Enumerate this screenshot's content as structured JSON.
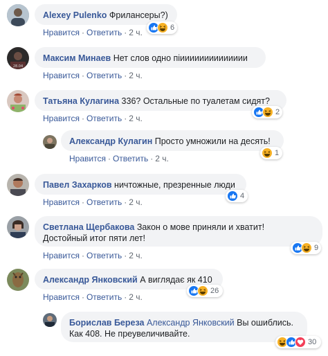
{
  "labels": {
    "like": "Нравится",
    "reply": "Ответить"
  },
  "comments": [
    {
      "author": "Alexey Pulenko",
      "text": "Фрилансеры?)",
      "time": "2 ч.",
      "reaction_count": "6"
    },
    {
      "author": "Максим Минаев",
      "text": "Нет слов одно пiииииииииииииии",
      "time": "2 ч.",
      "reaction_count": ""
    },
    {
      "author": "Татьяна Кулагина",
      "text": "336? Остальные по туалетам сидят?",
      "time": "2 ч.",
      "reaction_count": "2"
    },
    {
      "author": "Александр Кулагин",
      "text": "Просто умножили на десять!",
      "time": "2 ч.",
      "reaction_count": "1"
    },
    {
      "author": "Павел Захарков",
      "text": "ничтожные, презренные люди",
      "time": "2 ч.",
      "reaction_count": "4"
    },
    {
      "author": "Светлана Щербакова",
      "text": "Закон о мове приняли и хватит!",
      "text2": "Достойный итог пяти лет!",
      "time": "2 ч.",
      "reaction_count": "9"
    },
    {
      "author": "Александр Янковский",
      "text": "А виглядає як 410",
      "time": "2 ч.",
      "reaction_count": "26"
    },
    {
      "author": "Борислав Береза",
      "mention": "Александр Янковский",
      "text": "Вы ошиблись.",
      "text2": "Как 408. Не преувеличивайте.",
      "time": "2 ч.",
      "reaction_count": "30"
    }
  ],
  "colors": {
    "link": "#385898",
    "bubble": "#f2f3f5",
    "like_blue": "#1877f2",
    "haha_yellow": "#f7b125",
    "love_red": "#f33e58"
  }
}
